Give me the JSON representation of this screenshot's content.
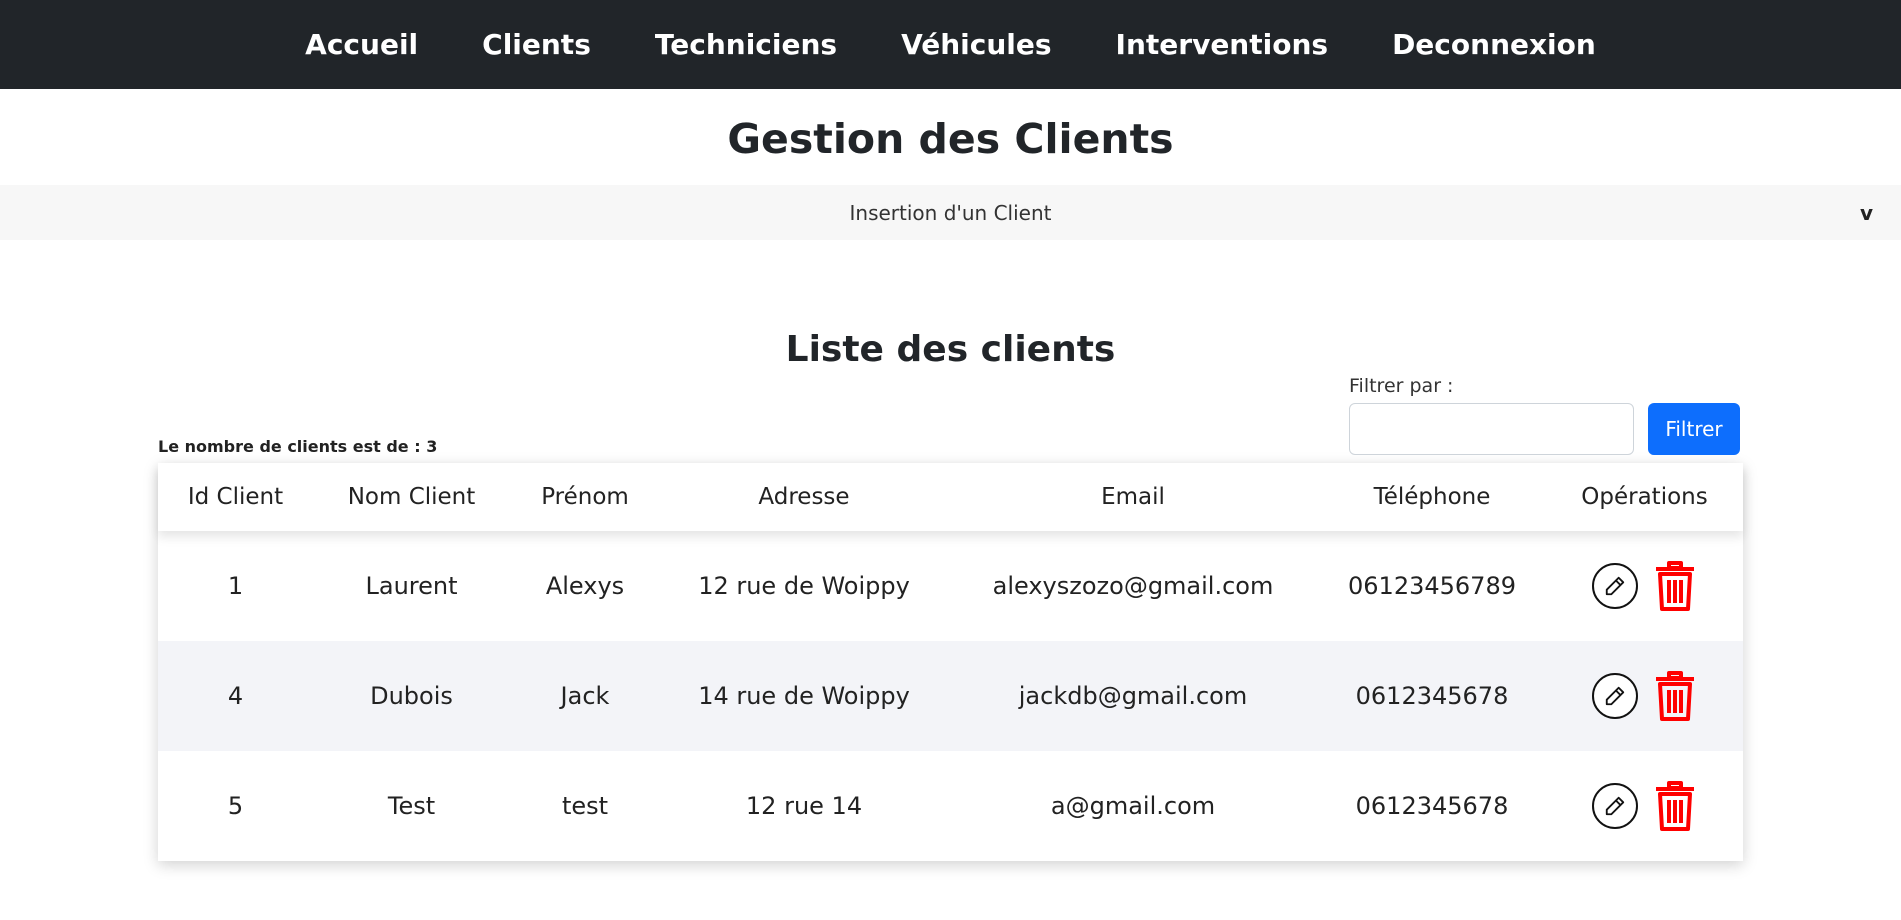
{
  "nav": {
    "items": [
      {
        "label": "Accueil"
      },
      {
        "label": "Clients"
      },
      {
        "label": "Techniciens"
      },
      {
        "label": "Véhicules"
      },
      {
        "label": "Interventions"
      },
      {
        "label": "Deconnexion"
      }
    ]
  },
  "page": {
    "title": "Gestion des Clients"
  },
  "accordion": {
    "title": "Insertion d'un Client",
    "chevron": "v"
  },
  "list": {
    "title": "Liste des clients",
    "count_text": "Le nombre de clients est de : 3",
    "filter": {
      "label": "Filtrer par :",
      "value": "",
      "placeholder": "",
      "button_label": "Filtrer"
    }
  },
  "table": {
    "headers": [
      "Id Client",
      "Nom Client",
      "Prénom",
      "Adresse",
      "Email",
      "Téléphone",
      "Opérations"
    ],
    "rows": [
      {
        "id": "1",
        "nom": "Laurent",
        "prenom": "Alexys",
        "adresse": "12 rue de Woippy",
        "email": "alexyszozo@gmail.com",
        "telephone": "06123456789"
      },
      {
        "id": "4",
        "nom": "Dubois",
        "prenom": "Jack",
        "adresse": "14 rue de Woippy",
        "email": "jackdb@gmail.com",
        "telephone": "0612345678"
      },
      {
        "id": "5",
        "nom": "Test",
        "prenom": "test",
        "adresse": "12 rue 14",
        "email": "a@gmail.com",
        "telephone": "0612345678"
      }
    ]
  },
  "icons": {
    "edit": "pencil-icon",
    "delete": "trash-icon"
  },
  "colors": {
    "navbar_bg": "#212529",
    "primary": "#0d6efd",
    "delete": "#ff0000",
    "row_stripe": "#f3f4f8"
  }
}
